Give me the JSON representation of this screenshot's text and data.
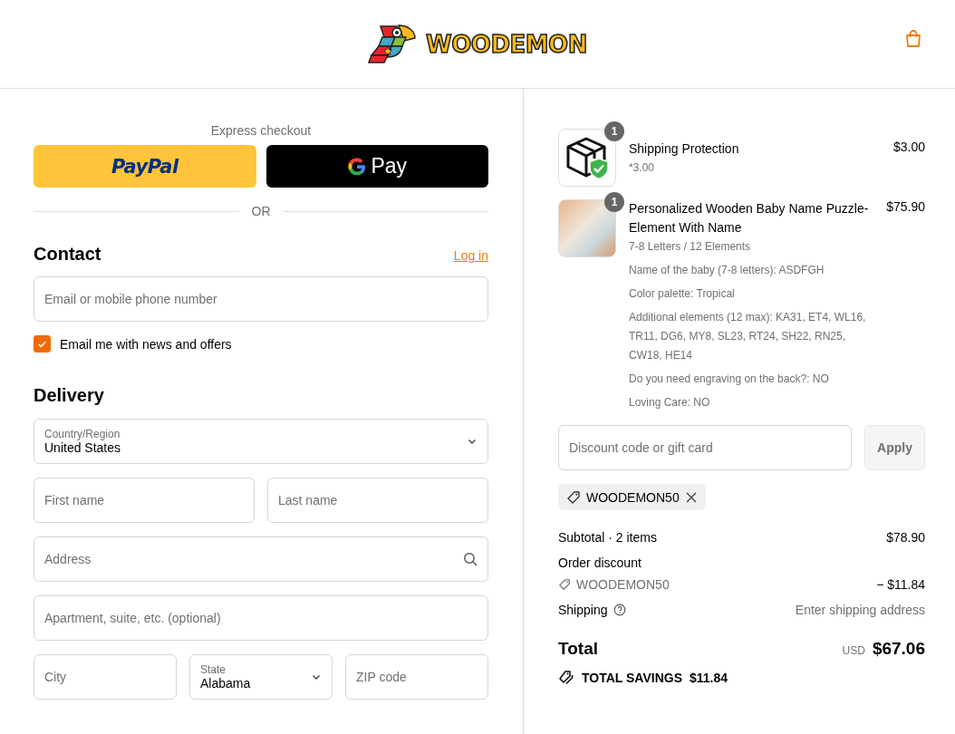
{
  "header": {
    "brand": "WOODEMON"
  },
  "express": {
    "title": "Express checkout",
    "buttons": [
      {
        "kind": "paypal",
        "label": "PayPal"
      },
      {
        "kind": "gpay",
        "label": "Pay"
      }
    ],
    "divider": "OR"
  },
  "contact": {
    "heading": "Contact",
    "login": "Log in",
    "email": {
      "placeholder": "Email or mobile phone number"
    },
    "newsletter": {
      "label": "Email me with news and offers",
      "checked": true
    }
  },
  "delivery": {
    "heading": "Delivery",
    "rows": [
      [
        {
          "kind": "select",
          "label": "Country/Region",
          "value": "United States"
        }
      ],
      [
        {
          "kind": "text",
          "placeholder": "First name"
        },
        {
          "kind": "text",
          "placeholder": "Last name"
        }
      ],
      [
        {
          "kind": "search",
          "placeholder": "Address"
        }
      ],
      [
        {
          "kind": "text",
          "placeholder": "Apartment, suite, etc. (optional)"
        }
      ],
      [
        {
          "kind": "text",
          "placeholder": "City"
        },
        {
          "kind": "select",
          "label": "State",
          "value": "Alabama"
        },
        {
          "kind": "text",
          "placeholder": "ZIP code"
        }
      ]
    ]
  },
  "summary": {
    "items": [
      {
        "kind": "protection",
        "quantity": "1",
        "name": "Shipping Protection",
        "details": [
          "*3.00"
        ],
        "price": "$3.00"
      },
      {
        "kind": "photo",
        "quantity": "1",
        "name": "Personalized Wooden Baby Name Puzzle-Element With Name",
        "details": [
          "7-8 Letters / 12 Elements",
          "Name of the baby (7-8 letters): ASDFGH",
          "Color palette: Tropical",
          "Additional elements (12 max): KA31, ET4, WL16, TR11, DG6, MY8, SL23, RT24, SH22, RN25, CW18, HE14",
          "Do you need engraving on the back?: NO",
          "Loving Care: NO"
        ],
        "price": "$75.90"
      }
    ],
    "discount": {
      "placeholder": "Discount code or gift card",
      "button": "Apply",
      "codes": [
        "WOODEMON50"
      ]
    },
    "subtotal": {
      "label": "Subtotal · 2 items",
      "value": "$78.90"
    },
    "order_discount": {
      "label": "Order discount",
      "code": "WOODEMON50",
      "value": "− $11.84"
    },
    "shipping": {
      "label": "Shipping",
      "value": "Enter shipping address"
    },
    "total": {
      "label": "Total",
      "currency": "USD",
      "value": "$67.06"
    },
    "savings": {
      "label": "TOTAL SAVINGS",
      "value": "$11.84"
    }
  }
}
